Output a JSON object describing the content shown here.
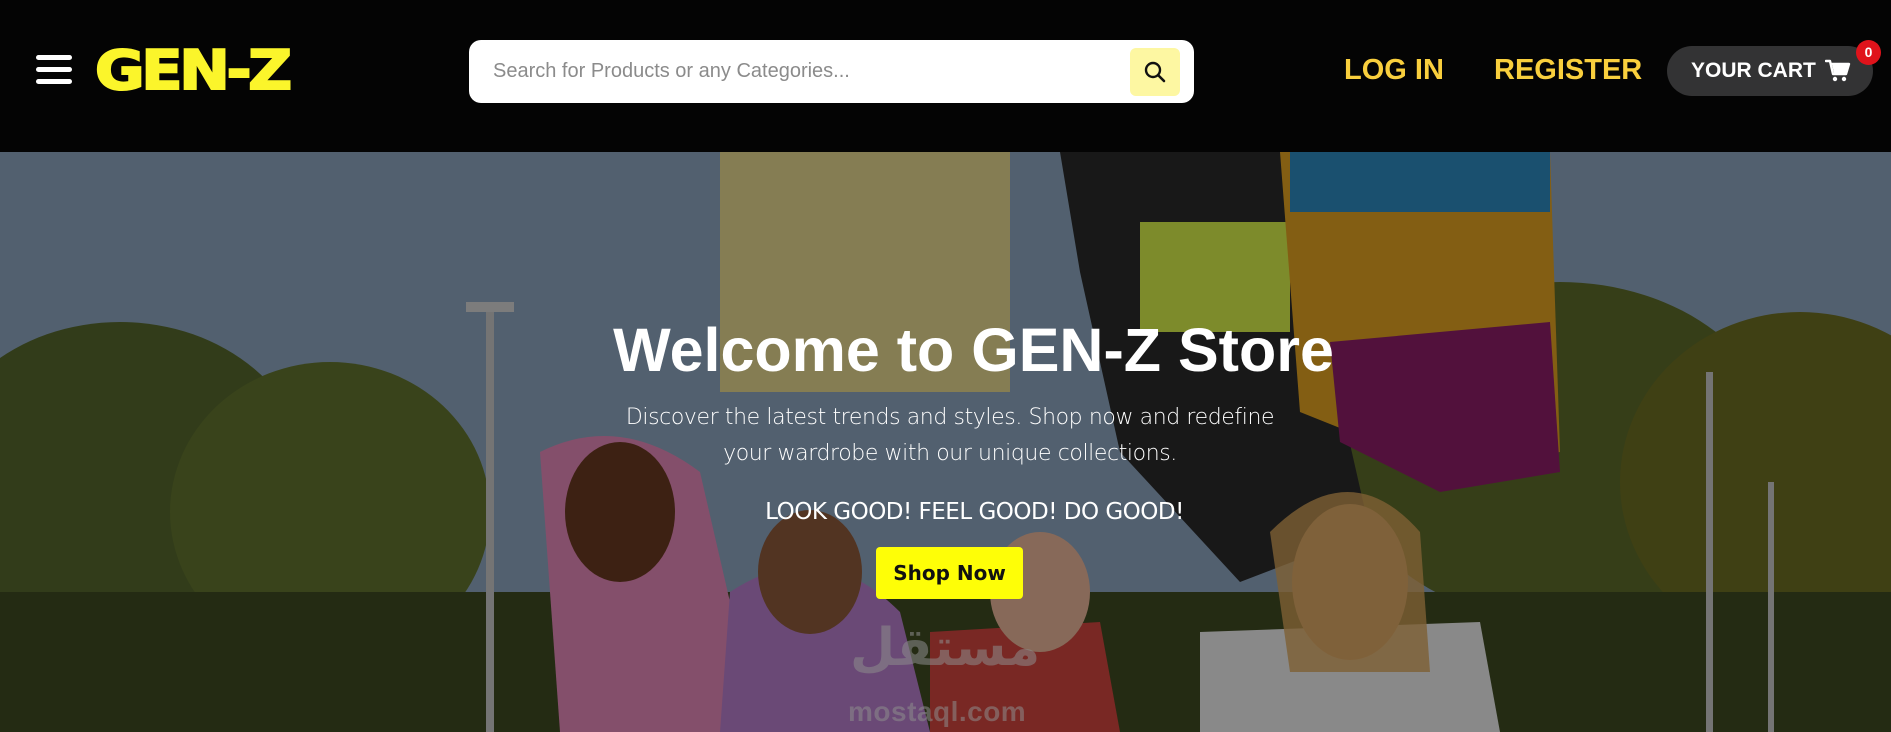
{
  "header": {
    "menu_icon": "hamburger-menu-icon",
    "logo_text": "GEN-Z",
    "search": {
      "placeholder": "Search for Products or any Categories...",
      "value": "",
      "icon": "search-icon"
    },
    "login_label": "LOG IN",
    "register_label": "REGISTER",
    "cart": {
      "label": "YOUR CART",
      "icon": "shopping-cart-icon",
      "count": "0"
    }
  },
  "hero": {
    "title": "Welcome to GEN-Z Store",
    "subtitle": "Discover the latest trends and styles. Shop now and redefine your wardrobe with our unique collections.",
    "slogan": "LOOK GOOD! FEEL GOOD! DO GOOD!",
    "cta_label": "Shop Now"
  },
  "watermark": {
    "arabic": "مستقل",
    "latin": "mostaql.com"
  },
  "colors": {
    "brand_yellow": "#fbf52b",
    "nav_gold": "#f9cf3d",
    "cta_yellow": "#fefe07",
    "badge_red": "#e0131b",
    "header_bg": "#040404"
  }
}
